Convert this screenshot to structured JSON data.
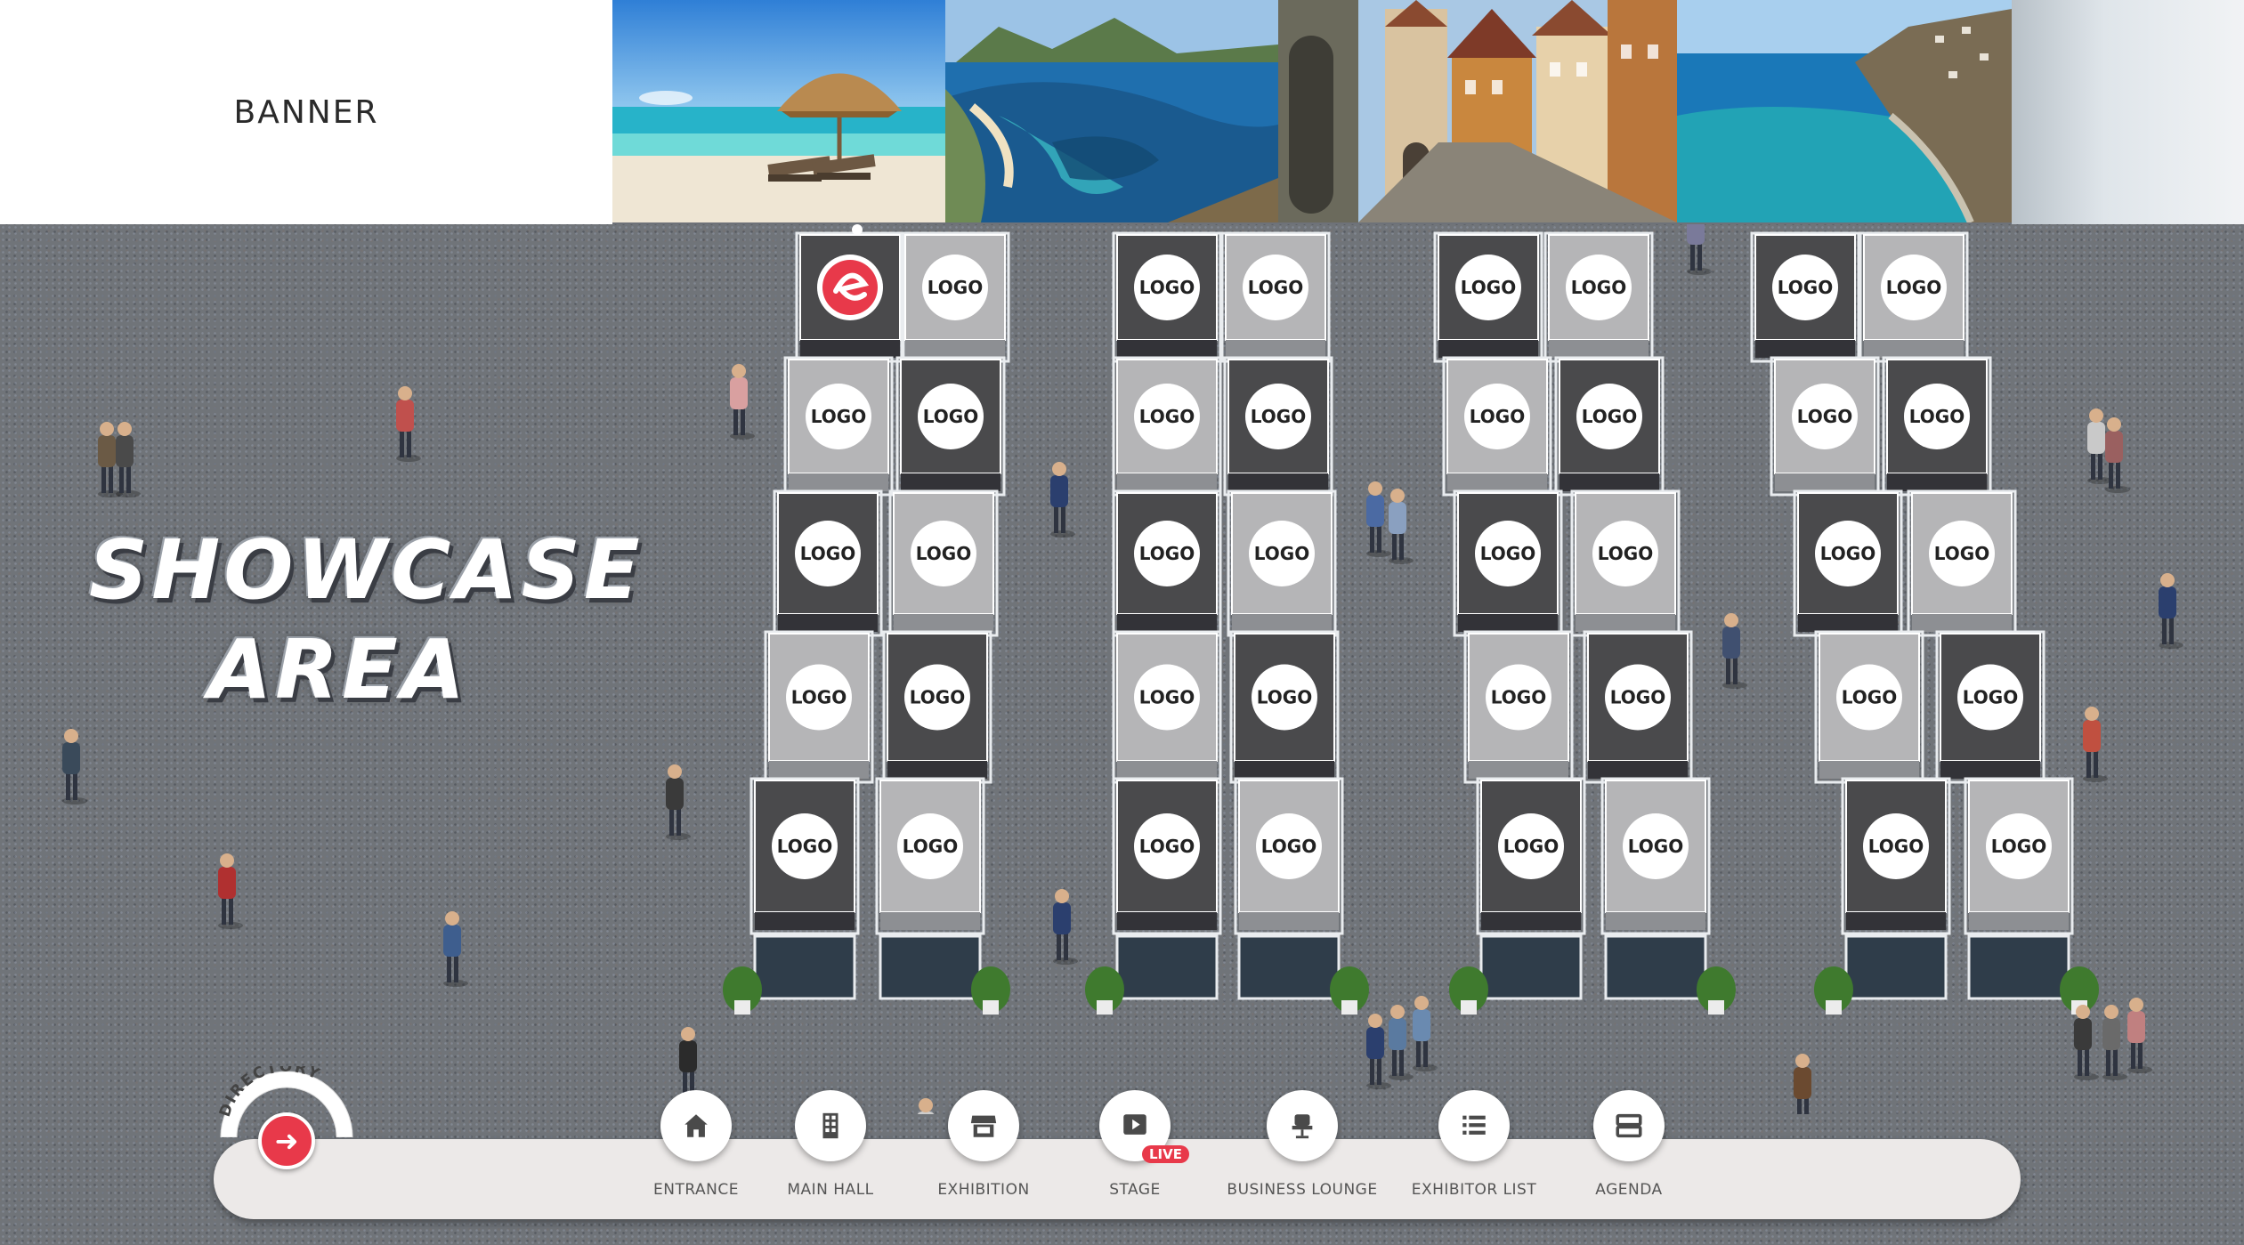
{
  "banner": {
    "label": "BANNER"
  },
  "photos": [
    {
      "icon": "beach-umbrella-photo"
    },
    {
      "icon": "coastal-bay-photo"
    },
    {
      "icon": "old-town-street-photo"
    },
    {
      "icon": "cliff-coast-photo"
    }
  ],
  "hall": {
    "title_line1": "SHOWCASE",
    "title_line2": "AREA"
  },
  "booths": {
    "logo_text": "LOGO",
    "accent_logo_icon": "brand-e-logo-icon",
    "dark_color": "#4a4a4c",
    "light_color": "#b5b5b7"
  },
  "directory": {
    "label": "DIRECTORY",
    "icon": "arrow-right-icon"
  },
  "nav": {
    "items": [
      {
        "label": "ENTRANCE",
        "icon": "home-icon"
      },
      {
        "label": "MAIN HALL",
        "icon": "building-icon"
      },
      {
        "label": "EXHIBITION",
        "icon": "storefront-icon"
      },
      {
        "label": "STAGE",
        "icon": "play-icon",
        "badge": "LIVE"
      },
      {
        "label": "BUSINESS LOUNGE",
        "icon": "chair-icon"
      },
      {
        "label": "EXHIBITOR LIST",
        "icon": "list-icon"
      },
      {
        "label": "AGENDA",
        "icon": "agenda-icon"
      }
    ],
    "accent_color": "#e8394a"
  }
}
